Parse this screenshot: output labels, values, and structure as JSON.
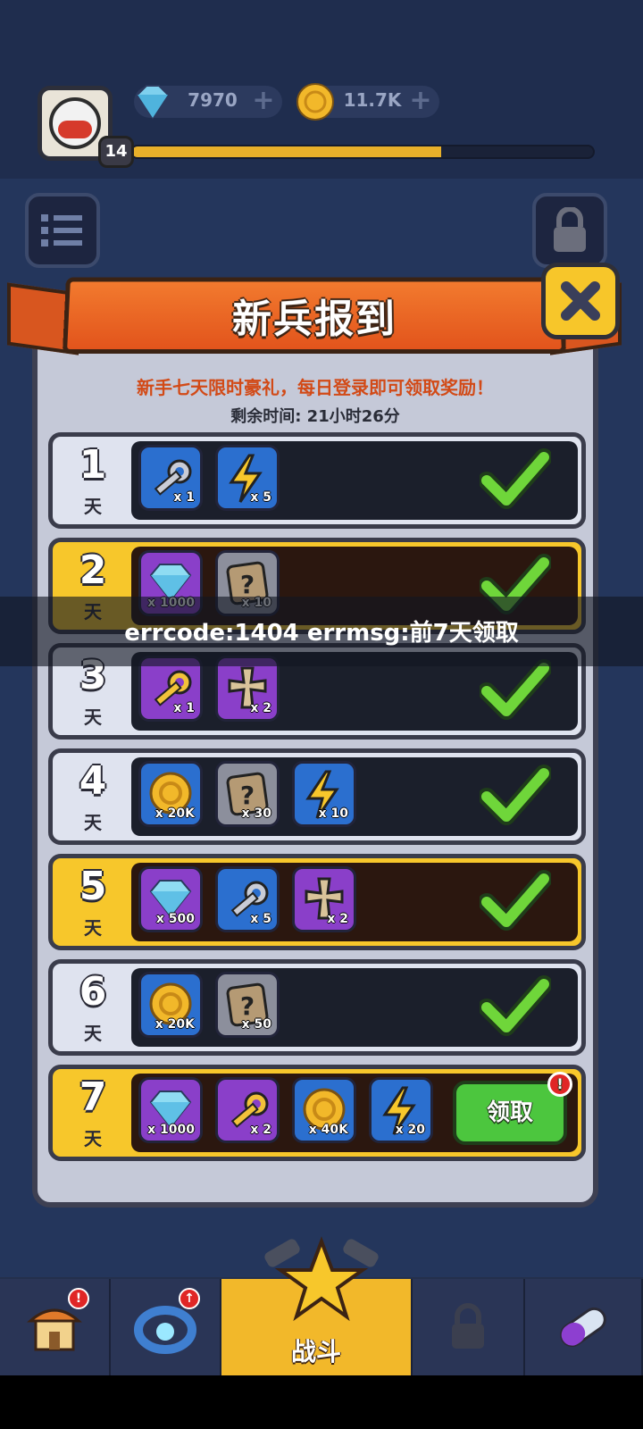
{
  "header": {
    "level": "14",
    "gems": "7970",
    "coins": "11.7K",
    "xp_progress": 0.67
  },
  "dialog": {
    "title": "新兵报到",
    "subtitle": "新手七天限时豪礼，每日登录即可领取奖励！",
    "remaining_time": "剩余时间: 21小时26分",
    "day_suffix": "天",
    "claim_label": "领取",
    "claim_alert": "!"
  },
  "days": [
    {
      "day": "1",
      "style": "normal",
      "claimed": true,
      "items": [
        {
          "icon": "silver-key-icon",
          "bg": "blue",
          "qty": "x 1"
        },
        {
          "icon": "lightning-icon",
          "bg": "blue",
          "qty": "x 5"
        }
      ]
    },
    {
      "day": "2",
      "style": "gold",
      "claimed": true,
      "items": [
        {
          "icon": "gem-icon",
          "bg": "purple",
          "qty": "x 1000"
        },
        {
          "icon": "mystery-scroll-icon",
          "bg": "gray",
          "qty": "x 10"
        }
      ]
    },
    {
      "day": "3",
      "style": "normal",
      "claimed": true,
      "items": [
        {
          "icon": "gold-key-icon",
          "bg": "purple",
          "qty": "x 1"
        },
        {
          "icon": "cross-emblem-icon",
          "bg": "purple",
          "qty": "x 2"
        }
      ]
    },
    {
      "day": "4",
      "style": "normal",
      "claimed": true,
      "items": [
        {
          "icon": "coin-icon",
          "bg": "blue",
          "qty": "x 20K"
        },
        {
          "icon": "mystery-scroll-icon",
          "bg": "gray",
          "qty": "x 30"
        },
        {
          "icon": "lightning-icon",
          "bg": "blue",
          "qty": "x 10"
        }
      ]
    },
    {
      "day": "5",
      "style": "gold",
      "claimed": true,
      "items": [
        {
          "icon": "gem-icon",
          "bg": "purple",
          "qty": "x 500"
        },
        {
          "icon": "silver-key-icon",
          "bg": "blue",
          "qty": "x 5"
        },
        {
          "icon": "cross-emblem-icon",
          "bg": "purple",
          "qty": "x 2"
        }
      ]
    },
    {
      "day": "6",
      "style": "normal",
      "claimed": true,
      "items": [
        {
          "icon": "coin-icon",
          "bg": "blue",
          "qty": "x 20K"
        },
        {
          "icon": "mystery-scroll-icon",
          "bg": "gray",
          "qty": "x 50"
        }
      ]
    },
    {
      "day": "7",
      "style": "gold",
      "claimed": false,
      "items": [
        {
          "icon": "gem-icon",
          "bg": "purple",
          "qty": "x 1000"
        },
        {
          "icon": "gold-key-icon",
          "bg": "purple",
          "qty": "x 2"
        },
        {
          "icon": "coin-icon",
          "bg": "blue",
          "qty": "x 40K"
        },
        {
          "icon": "lightning-icon",
          "bg": "blue",
          "qty": "x 20"
        }
      ]
    }
  ],
  "toast": {
    "text": "errcode:1404 errmsg:前7天领取"
  },
  "nav": {
    "battle_label": "战斗",
    "alert": "!",
    "upgrade": "↑"
  },
  "colors": {
    "ribbon": "#e2541c",
    "gold_row": "#f7c72b",
    "check": "#6fd63a",
    "claim": "#4cc63e"
  }
}
